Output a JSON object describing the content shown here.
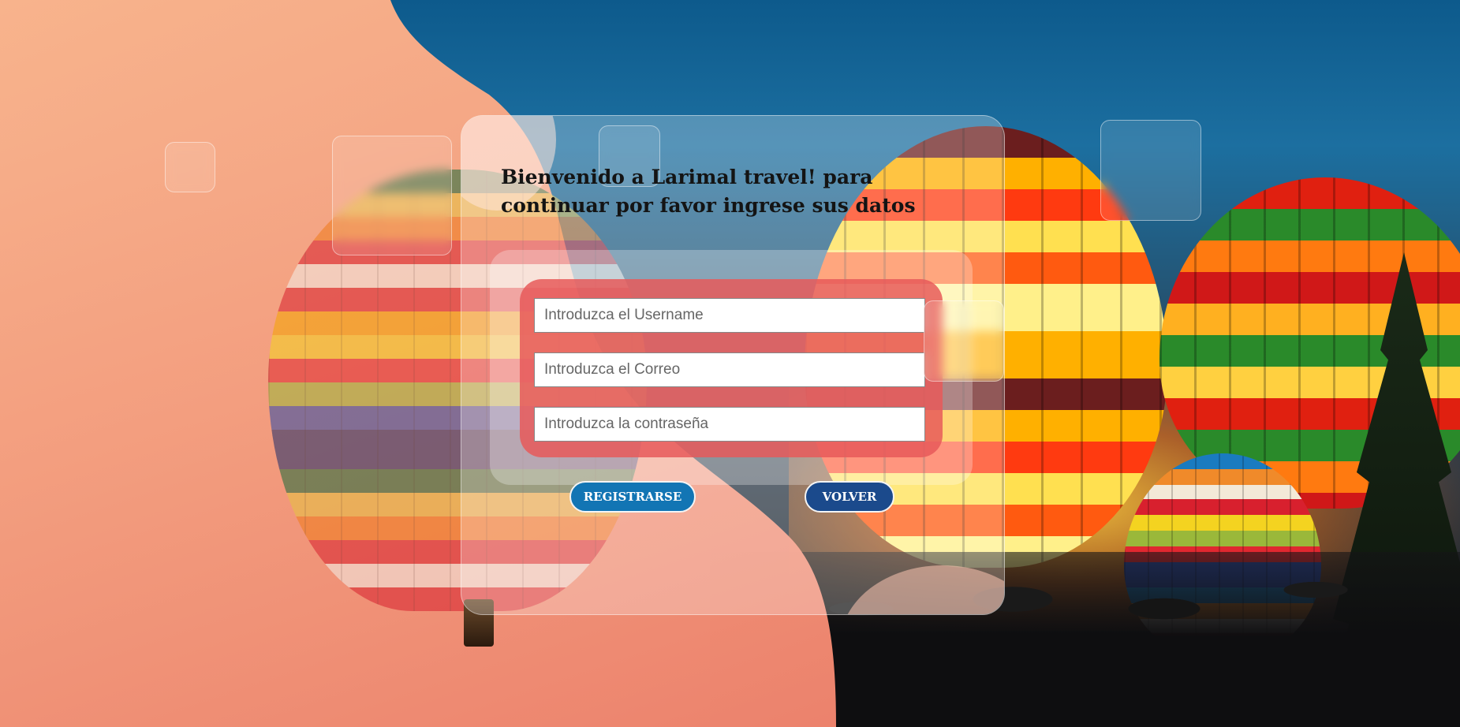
{
  "page": {
    "title": "Bienvenido a Larimal travel! para continuar por favor ingrese sus datos"
  },
  "form": {
    "username_placeholder": "Introduzca el Username",
    "email_placeholder": "Introduzca el Correo",
    "password_placeholder": "Introduzca la contraseña",
    "register_label": "REGISTRARSE",
    "back_label": "VOLVER"
  },
  "colors": {
    "coral_background": "#f79a80",
    "form_box": "#e85a5a",
    "register_button": "#1275b4",
    "back_button": "#1b4a8c"
  }
}
